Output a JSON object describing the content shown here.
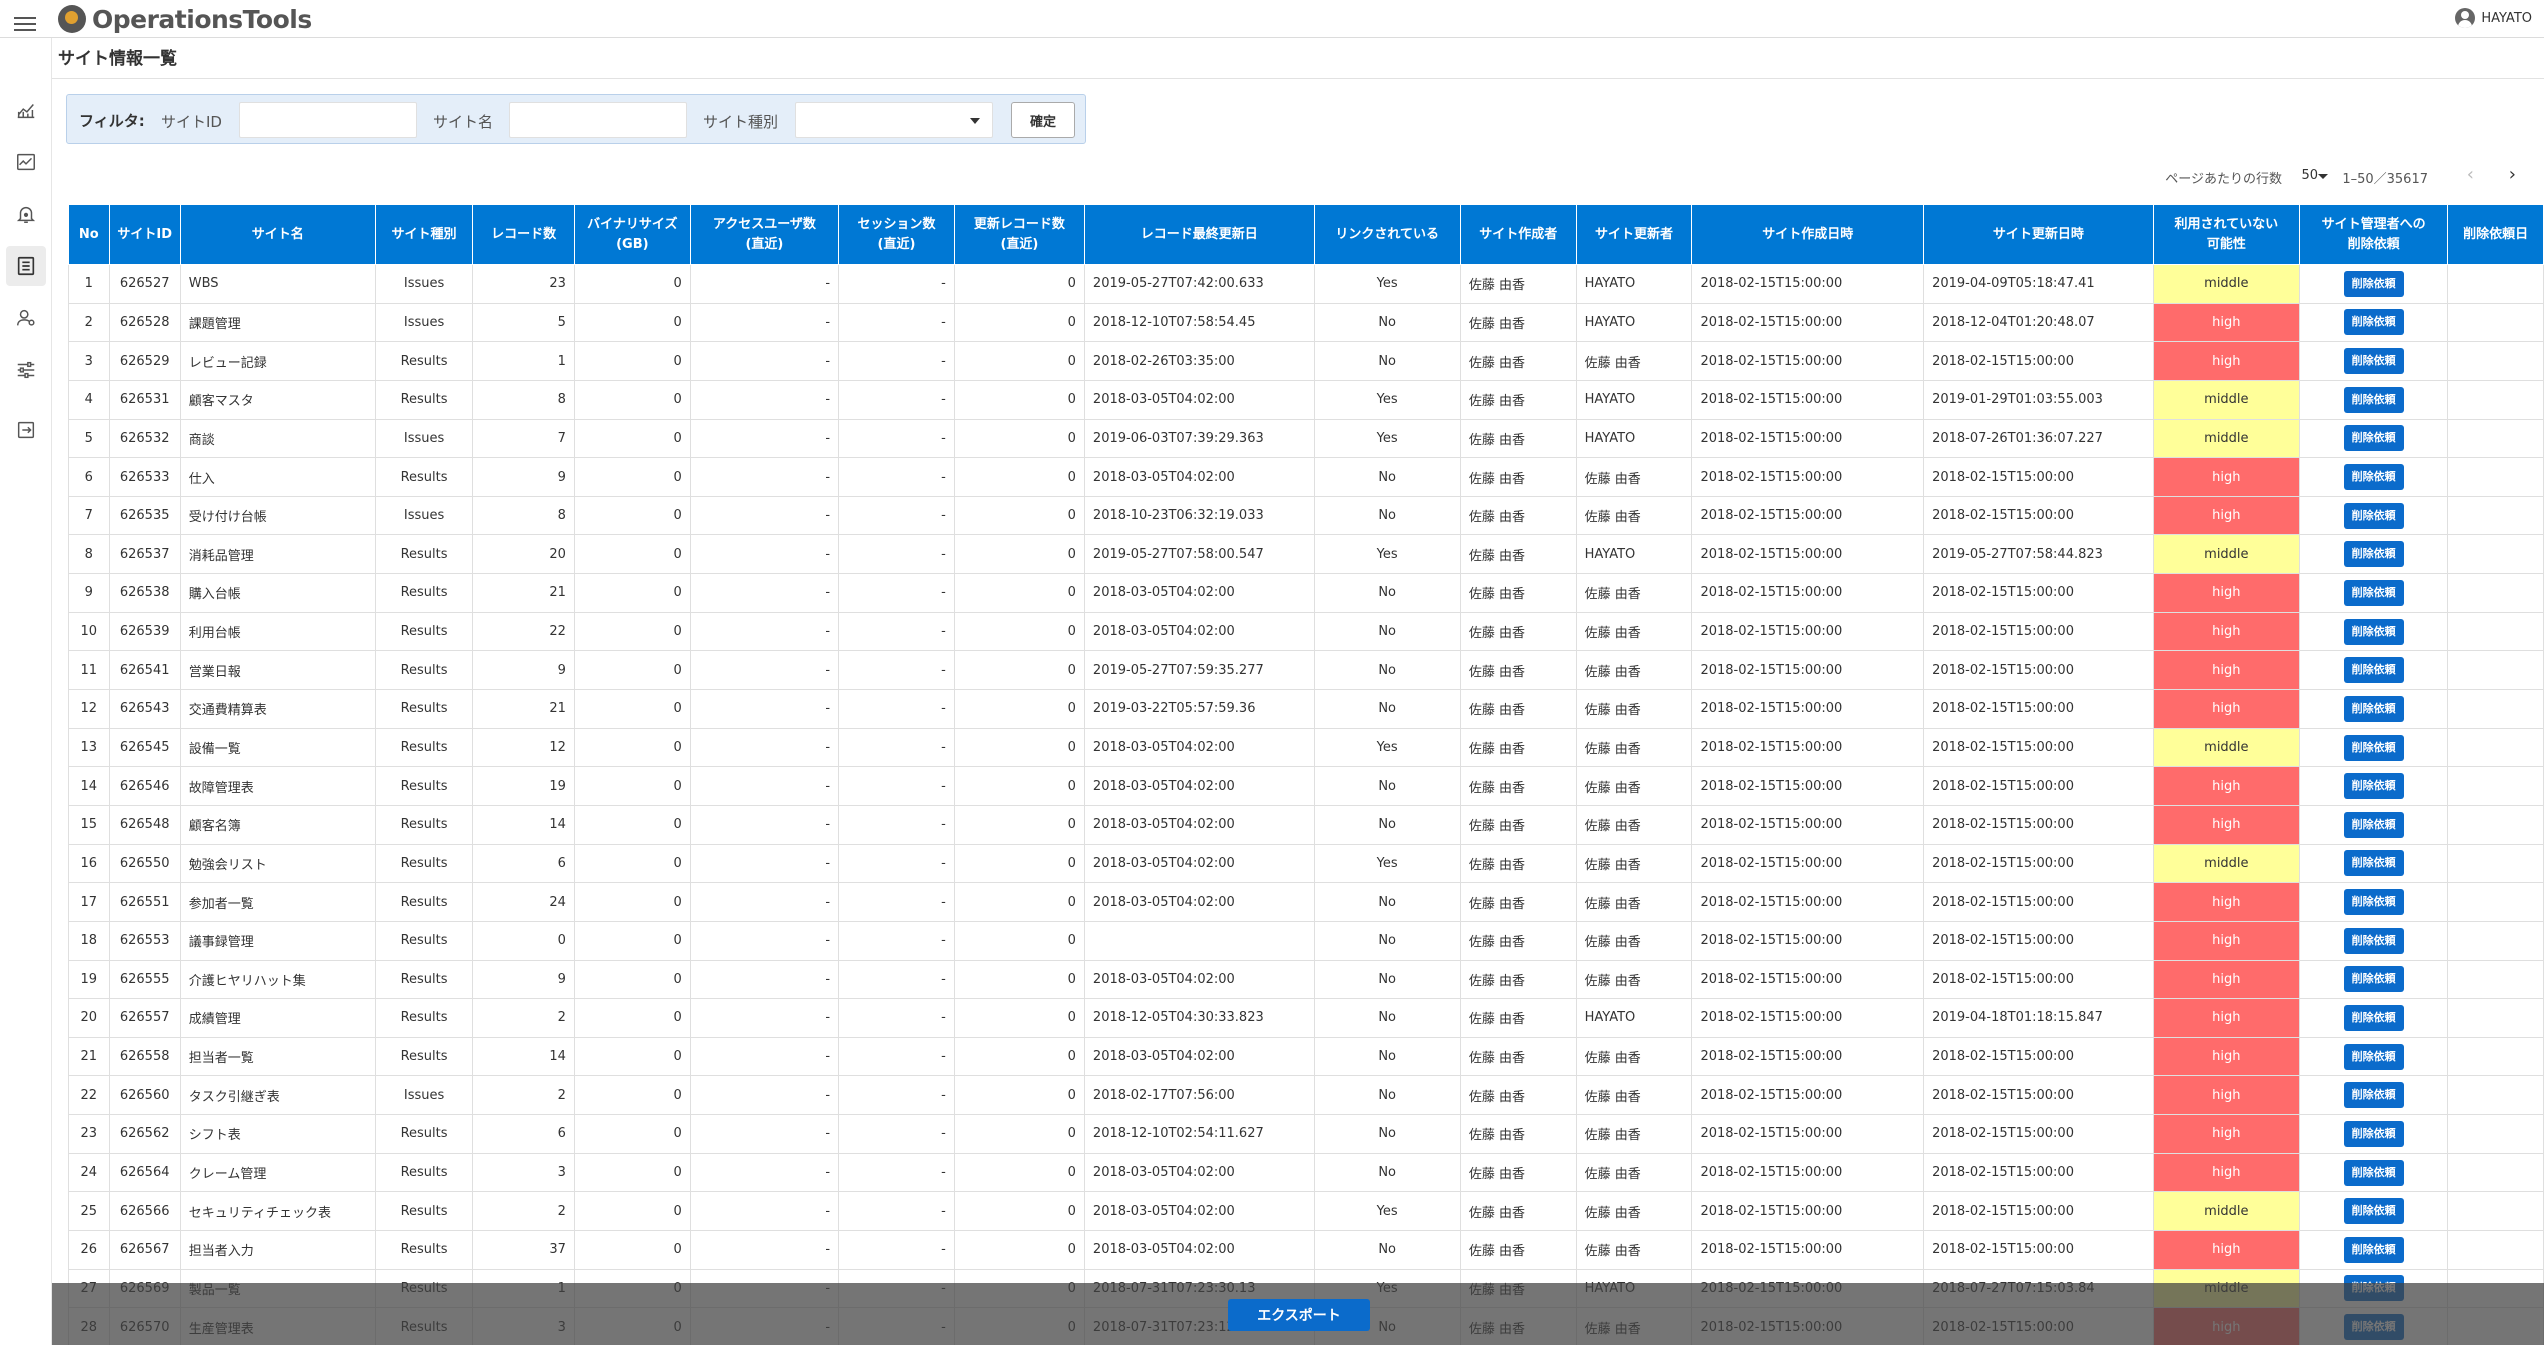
{
  "app": {
    "title": "OperationsTools",
    "user": "HAYATO"
  },
  "page": {
    "title": "サイト情報一覧"
  },
  "filter": {
    "label": "フィルタ:",
    "site_id_label": "サイトID",
    "site_id_value": "",
    "site_name_label": "サイト名",
    "site_name_value": "",
    "site_type_label": "サイト種別",
    "site_type_value": "",
    "confirm_label": "確定"
  },
  "pager": {
    "rows_per_page_label": "ページあたりの行数",
    "rows_per_page": "50",
    "range": "1–50／35617",
    "prev_icon": "chevron-left-icon",
    "next_icon": "chevron-right-icon"
  },
  "sidebar": {
    "items": [
      {
        "icon": "line-chart-icon"
      },
      {
        "icon": "dashboard-chart-icon"
      },
      {
        "icon": "bell-alert-icon"
      },
      {
        "icon": "list-document-icon",
        "active": true
      },
      {
        "icon": "user-settings-icon"
      },
      {
        "icon": "sliders-icon"
      },
      {
        "icon": "logout-icon"
      }
    ]
  },
  "colors": {
    "header_blue": "#0078d4",
    "high": "#ff6b6b",
    "middle": "#ffff99",
    "button_blue": "#0b6bcb"
  },
  "table": {
    "headers": [
      "No",
      "サイトID",
      "サイト名",
      "サイト種別",
      "レコード数",
      "バイナリサイズ\n(GB)",
      "アクセスユーザ数\n(直近)",
      "セッション数\n(直近)",
      "更新レコード数\n(直近)",
      "レコード最終更新日",
      "リンクされている",
      "サイト作成者",
      "サイト更新者",
      "サイト作成日時",
      "サイト更新日時",
      "利用されていない\n可能性",
      "サイト管理者への\n削除依頼",
      "削除依頼日"
    ],
    "delete_button_label": "削除依頼",
    "rows": [
      {
        "no": "1",
        "id": "626527",
        "name": "WBS",
        "type": "Issues",
        "records": "23",
        "binary": "0",
        "access": "-",
        "session": "-",
        "updated": "0",
        "last": "2019-05-27T07:42:00.633",
        "linked": "Yes",
        "creator": "佐藤 由香",
        "updater": "HAYATO",
        "created_at": "2018-02-15T15:00:00",
        "updated_at": "2019-04-09T05:18:47.41",
        "possibility": "middle",
        "req_date": ""
      },
      {
        "no": "2",
        "id": "626528",
        "name": "課題管理",
        "type": "Issues",
        "records": "5",
        "binary": "0",
        "access": "-",
        "session": "-",
        "updated": "0",
        "last": "2018-12-10T07:58:54.45",
        "linked": "No",
        "creator": "佐藤 由香",
        "updater": "HAYATO",
        "created_at": "2018-02-15T15:00:00",
        "updated_at": "2018-12-04T01:20:48.07",
        "possibility": "high",
        "req_date": ""
      },
      {
        "no": "3",
        "id": "626529",
        "name": "レビュー記録",
        "type": "Results",
        "records": "1",
        "binary": "0",
        "access": "-",
        "session": "-",
        "updated": "0",
        "last": "2018-02-26T03:35:00",
        "linked": "No",
        "creator": "佐藤 由香",
        "updater": "佐藤 由香",
        "created_at": "2018-02-15T15:00:00",
        "updated_at": "2018-02-15T15:00:00",
        "possibility": "high",
        "req_date": ""
      },
      {
        "no": "4",
        "id": "626531",
        "name": "顧客マスタ",
        "type": "Results",
        "records": "8",
        "binary": "0",
        "access": "-",
        "session": "-",
        "updated": "0",
        "last": "2018-03-05T04:02:00",
        "linked": "Yes",
        "creator": "佐藤 由香",
        "updater": "HAYATO",
        "created_at": "2018-02-15T15:00:00",
        "updated_at": "2019-01-29T01:03:55.003",
        "possibility": "middle",
        "req_date": ""
      },
      {
        "no": "5",
        "id": "626532",
        "name": "商談",
        "type": "Issues",
        "records": "7",
        "binary": "0",
        "access": "-",
        "session": "-",
        "updated": "0",
        "last": "2019-06-03T07:39:29.363",
        "linked": "Yes",
        "creator": "佐藤 由香",
        "updater": "HAYATO",
        "created_at": "2018-02-15T15:00:00",
        "updated_at": "2018-07-26T01:36:07.227",
        "possibility": "middle",
        "req_date": ""
      },
      {
        "no": "6",
        "id": "626533",
        "name": "仕入",
        "type": "Results",
        "records": "9",
        "binary": "0",
        "access": "-",
        "session": "-",
        "updated": "0",
        "last": "2018-03-05T04:02:00",
        "linked": "No",
        "creator": "佐藤 由香",
        "updater": "佐藤 由香",
        "created_at": "2018-02-15T15:00:00",
        "updated_at": "2018-02-15T15:00:00",
        "possibility": "high",
        "req_date": ""
      },
      {
        "no": "7",
        "id": "626535",
        "name": "受け付け台帳",
        "type": "Issues",
        "records": "8",
        "binary": "0",
        "access": "-",
        "session": "-",
        "updated": "0",
        "last": "2018-10-23T06:32:19.033",
        "linked": "No",
        "creator": "佐藤 由香",
        "updater": "佐藤 由香",
        "created_at": "2018-02-15T15:00:00",
        "updated_at": "2018-02-15T15:00:00",
        "possibility": "high",
        "req_date": ""
      },
      {
        "no": "8",
        "id": "626537",
        "name": "消耗品管理",
        "type": "Results",
        "records": "20",
        "binary": "0",
        "access": "-",
        "session": "-",
        "updated": "0",
        "last": "2019-05-27T07:58:00.547",
        "linked": "Yes",
        "creator": "佐藤 由香",
        "updater": "HAYATO",
        "created_at": "2018-02-15T15:00:00",
        "updated_at": "2019-05-27T07:58:44.823",
        "possibility": "middle",
        "req_date": ""
      },
      {
        "no": "9",
        "id": "626538",
        "name": "購入台帳",
        "type": "Results",
        "records": "21",
        "binary": "0",
        "access": "-",
        "session": "-",
        "updated": "0",
        "last": "2018-03-05T04:02:00",
        "linked": "No",
        "creator": "佐藤 由香",
        "updater": "佐藤 由香",
        "created_at": "2018-02-15T15:00:00",
        "updated_at": "2018-02-15T15:00:00",
        "possibility": "high",
        "req_date": ""
      },
      {
        "no": "10",
        "id": "626539",
        "name": "利用台帳",
        "type": "Results",
        "records": "22",
        "binary": "0",
        "access": "-",
        "session": "-",
        "updated": "0",
        "last": "2018-03-05T04:02:00",
        "linked": "No",
        "creator": "佐藤 由香",
        "updater": "佐藤 由香",
        "created_at": "2018-02-15T15:00:00",
        "updated_at": "2018-02-15T15:00:00",
        "possibility": "high",
        "req_date": ""
      },
      {
        "no": "11",
        "id": "626541",
        "name": "営業日報",
        "type": "Results",
        "records": "9",
        "binary": "0",
        "access": "-",
        "session": "-",
        "updated": "0",
        "last": "2019-05-27T07:59:35.277",
        "linked": "No",
        "creator": "佐藤 由香",
        "updater": "佐藤 由香",
        "created_at": "2018-02-15T15:00:00",
        "updated_at": "2018-02-15T15:00:00",
        "possibility": "high",
        "req_date": ""
      },
      {
        "no": "12",
        "id": "626543",
        "name": "交通費精算表",
        "type": "Results",
        "records": "21",
        "binary": "0",
        "access": "-",
        "session": "-",
        "updated": "0",
        "last": "2019-03-22T05:57:59.36",
        "linked": "No",
        "creator": "佐藤 由香",
        "updater": "佐藤 由香",
        "created_at": "2018-02-15T15:00:00",
        "updated_at": "2018-02-15T15:00:00",
        "possibility": "high",
        "req_date": ""
      },
      {
        "no": "13",
        "id": "626545",
        "name": "設備一覧",
        "type": "Results",
        "records": "12",
        "binary": "0",
        "access": "-",
        "session": "-",
        "updated": "0",
        "last": "2018-03-05T04:02:00",
        "linked": "Yes",
        "creator": "佐藤 由香",
        "updater": "佐藤 由香",
        "created_at": "2018-02-15T15:00:00",
        "updated_at": "2018-02-15T15:00:00",
        "possibility": "middle",
        "req_date": ""
      },
      {
        "no": "14",
        "id": "626546",
        "name": "故障管理表",
        "type": "Results",
        "records": "19",
        "binary": "0",
        "access": "-",
        "session": "-",
        "updated": "0",
        "last": "2018-03-05T04:02:00",
        "linked": "No",
        "creator": "佐藤 由香",
        "updater": "佐藤 由香",
        "created_at": "2018-02-15T15:00:00",
        "updated_at": "2018-02-15T15:00:00",
        "possibility": "high",
        "req_date": ""
      },
      {
        "no": "15",
        "id": "626548",
        "name": "顧客名簿",
        "type": "Results",
        "records": "14",
        "binary": "0",
        "access": "-",
        "session": "-",
        "updated": "0",
        "last": "2018-03-05T04:02:00",
        "linked": "No",
        "creator": "佐藤 由香",
        "updater": "佐藤 由香",
        "created_at": "2018-02-15T15:00:00",
        "updated_at": "2018-02-15T15:00:00",
        "possibility": "high",
        "req_date": ""
      },
      {
        "no": "16",
        "id": "626550",
        "name": "勉強会リスト",
        "type": "Results",
        "records": "6",
        "binary": "0",
        "access": "-",
        "session": "-",
        "updated": "0",
        "last": "2018-03-05T04:02:00",
        "linked": "Yes",
        "creator": "佐藤 由香",
        "updater": "佐藤 由香",
        "created_at": "2018-02-15T15:00:00",
        "updated_at": "2018-02-15T15:00:00",
        "possibility": "middle",
        "req_date": ""
      },
      {
        "no": "17",
        "id": "626551",
        "name": "参加者一覧",
        "type": "Results",
        "records": "24",
        "binary": "0",
        "access": "-",
        "session": "-",
        "updated": "0",
        "last": "2018-03-05T04:02:00",
        "linked": "No",
        "creator": "佐藤 由香",
        "updater": "佐藤 由香",
        "created_at": "2018-02-15T15:00:00",
        "updated_at": "2018-02-15T15:00:00",
        "possibility": "high",
        "req_date": ""
      },
      {
        "no": "18",
        "id": "626553",
        "name": "議事録管理",
        "type": "Results",
        "records": "0",
        "binary": "0",
        "access": "-",
        "session": "-",
        "updated": "0",
        "last": "",
        "linked": "No",
        "creator": "佐藤 由香",
        "updater": "佐藤 由香",
        "created_at": "2018-02-15T15:00:00",
        "updated_at": "2018-02-15T15:00:00",
        "possibility": "high",
        "req_date": ""
      },
      {
        "no": "19",
        "id": "626555",
        "name": "介護ヒヤリハット集",
        "type": "Results",
        "records": "9",
        "binary": "0",
        "access": "-",
        "session": "-",
        "updated": "0",
        "last": "2018-03-05T04:02:00",
        "linked": "No",
        "creator": "佐藤 由香",
        "updater": "佐藤 由香",
        "created_at": "2018-02-15T15:00:00",
        "updated_at": "2018-02-15T15:00:00",
        "possibility": "high",
        "req_date": ""
      },
      {
        "no": "20",
        "id": "626557",
        "name": "成績管理",
        "type": "Results",
        "records": "2",
        "binary": "0",
        "access": "-",
        "session": "-",
        "updated": "0",
        "last": "2018-12-05T04:30:33.823",
        "linked": "No",
        "creator": "佐藤 由香",
        "updater": "HAYATO",
        "created_at": "2018-02-15T15:00:00",
        "updated_at": "2019-04-18T01:18:15.847",
        "possibility": "high",
        "req_date": ""
      },
      {
        "no": "21",
        "id": "626558",
        "name": "担当者一覧",
        "type": "Results",
        "records": "14",
        "binary": "0",
        "access": "-",
        "session": "-",
        "updated": "0",
        "last": "2018-03-05T04:02:00",
        "linked": "No",
        "creator": "佐藤 由香",
        "updater": "佐藤 由香",
        "created_at": "2018-02-15T15:00:00",
        "updated_at": "2018-02-15T15:00:00",
        "possibility": "high",
        "req_date": ""
      },
      {
        "no": "22",
        "id": "626560",
        "name": "タスク引継ぎ表",
        "type": "Issues",
        "records": "2",
        "binary": "0",
        "access": "-",
        "session": "-",
        "updated": "0",
        "last": "2018-02-17T07:56:00",
        "linked": "No",
        "creator": "佐藤 由香",
        "updater": "佐藤 由香",
        "created_at": "2018-02-15T15:00:00",
        "updated_at": "2018-02-15T15:00:00",
        "possibility": "high",
        "req_date": ""
      },
      {
        "no": "23",
        "id": "626562",
        "name": "シフト表",
        "type": "Results",
        "records": "6",
        "binary": "0",
        "access": "-",
        "session": "-",
        "updated": "0",
        "last": "2018-12-10T02:54:11.627",
        "linked": "No",
        "creator": "佐藤 由香",
        "updater": "佐藤 由香",
        "created_at": "2018-02-15T15:00:00",
        "updated_at": "2018-02-15T15:00:00",
        "possibility": "high",
        "req_date": ""
      },
      {
        "no": "24",
        "id": "626564",
        "name": "クレーム管理",
        "type": "Results",
        "records": "3",
        "binary": "0",
        "access": "-",
        "session": "-",
        "updated": "0",
        "last": "2018-03-05T04:02:00",
        "linked": "No",
        "creator": "佐藤 由香",
        "updater": "佐藤 由香",
        "created_at": "2018-02-15T15:00:00",
        "updated_at": "2018-02-15T15:00:00",
        "possibility": "high",
        "req_date": ""
      },
      {
        "no": "25",
        "id": "626566",
        "name": "セキュリティチェック表",
        "type": "Results",
        "records": "2",
        "binary": "0",
        "access": "-",
        "session": "-",
        "updated": "0",
        "last": "2018-03-05T04:02:00",
        "linked": "Yes",
        "creator": "佐藤 由香",
        "updater": "佐藤 由香",
        "created_at": "2018-02-15T15:00:00",
        "updated_at": "2018-02-15T15:00:00",
        "possibility": "middle",
        "req_date": ""
      },
      {
        "no": "26",
        "id": "626567",
        "name": "担当者入力",
        "type": "Results",
        "records": "37",
        "binary": "0",
        "access": "-",
        "session": "-",
        "updated": "0",
        "last": "2018-03-05T04:02:00",
        "linked": "No",
        "creator": "佐藤 由香",
        "updater": "佐藤 由香",
        "created_at": "2018-02-15T15:00:00",
        "updated_at": "2018-02-15T15:00:00",
        "possibility": "high",
        "req_date": ""
      },
      {
        "no": "27",
        "id": "626569",
        "name": "製品一覧",
        "type": "Results",
        "records": "1",
        "binary": "0",
        "access": "-",
        "session": "-",
        "updated": "0",
        "last": "2018-07-31T07:23:30.13",
        "linked": "Yes",
        "creator": "佐藤 由香",
        "updater": "HAYATO",
        "created_at": "2018-02-15T15:00:00",
        "updated_at": "2018-07-27T07:15:03.84",
        "possibility": "middle",
        "req_date": ""
      },
      {
        "no": "28",
        "id": "626570",
        "name": "生産管理表",
        "type": "Results",
        "records": "3",
        "binary": "0",
        "access": "-",
        "session": "-",
        "updated": "0",
        "last": "2018-07-31T07:23:12.03",
        "linked": "No",
        "creator": "佐藤 由香",
        "updater": "佐藤 由香",
        "created_at": "2018-02-15T15:00:00",
        "updated_at": "2018-02-15T15:00:00",
        "possibility": "high",
        "req_date": ""
      }
    ]
  },
  "export": {
    "label": "エクスポート"
  }
}
